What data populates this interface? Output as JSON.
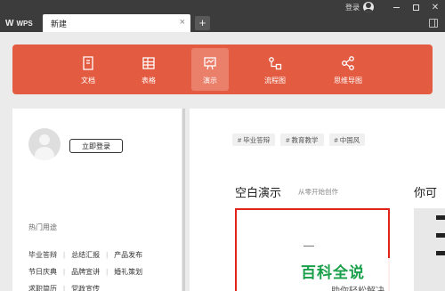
{
  "titlebar": {
    "app_name": "WPS",
    "tab_label": "新建",
    "tab_close": "×",
    "add_tab": "+",
    "login": "登录"
  },
  "banner": {
    "color": "#e35b40",
    "items": [
      {
        "label": "文档",
        "icon": "document-icon"
      },
      {
        "label": "表格",
        "icon": "table-icon"
      },
      {
        "label": "演示",
        "icon": "presentation-icon",
        "active": true
      },
      {
        "label": "流程图",
        "icon": "flowchart-icon"
      },
      {
        "label": "思维导图",
        "icon": "mindmap-icon"
      }
    ]
  },
  "left": {
    "login_button": "立即登录",
    "hot_title": "热门用途",
    "hot_rows": [
      [
        "毕业答辩",
        "总结汇报",
        "产品发布"
      ],
      [
        "节日庆典",
        "品牌宣讲",
        "婚礼策划"
      ],
      [
        "求职简历",
        "党政宣传"
      ]
    ]
  },
  "right": {
    "tags": [
      "# 毕业答辩",
      "# 教育教学",
      "# 中国风"
    ],
    "blank_title": "空白演示",
    "blank_subtitle": "从零开始创作",
    "right_title_partial": "你可"
  },
  "watermark": {
    "main": "百科全说",
    "sub": "助你轻松解决",
    "color": "#1aa04a"
  }
}
